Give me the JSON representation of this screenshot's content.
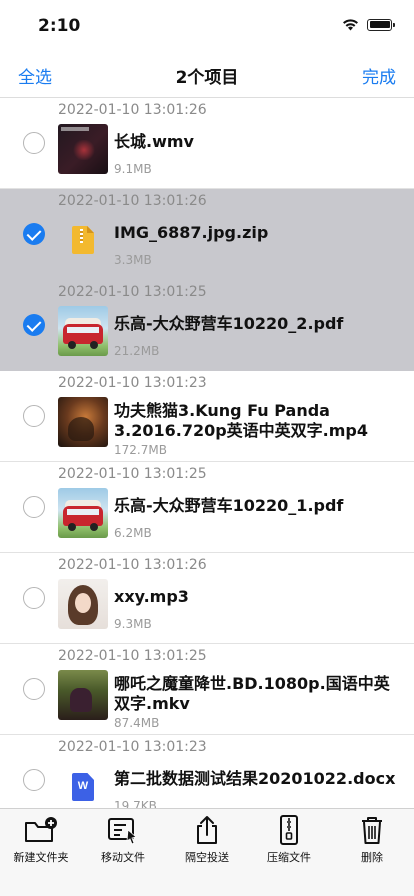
{
  "status_bar": {
    "time": "2:10"
  },
  "nav": {
    "select_all": "全选",
    "title": "2个项目",
    "done": "完成"
  },
  "files": [
    {
      "date": "2022-01-10 13:01:26",
      "name": "长城.wmv",
      "size": "9.1MB",
      "selected": false,
      "thumb": "video-thumbnail"
    },
    {
      "date": "2022-01-10 13:01:26",
      "name": "IMG_6887.jpg.zip",
      "size": "3.3MB",
      "selected": true,
      "thumb": "zip-icon"
    },
    {
      "date": "2022-01-10 13:01:25",
      "name": "乐高-大众野营车10220_2.pdf",
      "size": "21.2MB",
      "selected": true,
      "thumb": "pdf-thumbnail"
    },
    {
      "date": "2022-01-10 13:01:23",
      "name": "功夫熊猫3.Kung Fu Panda 3.2016.720p英语中英双字.mp4",
      "size": "172.7MB",
      "selected": false,
      "thumb": "video-thumbnail"
    },
    {
      "date": "2022-01-10 13:01:25",
      "name": "乐高-大众野营车10220_1.pdf",
      "size": "6.2MB",
      "selected": false,
      "thumb": "pdf-thumbnail"
    },
    {
      "date": "2022-01-10 13:01:26",
      "name": "xxy.mp3",
      "size": "9.3MB",
      "selected": false,
      "thumb": "album-art"
    },
    {
      "date": "2022-01-10 13:01:25",
      "name": "哪吒之魔童降世.BD.1080p.国语中英双字.mkv",
      "size": "87.4MB",
      "selected": false,
      "thumb": "video-thumbnail"
    },
    {
      "date": "2022-01-10 13:01:23",
      "name": "第二批数据测试结果20201022.docx",
      "size": "19.7KB",
      "selected": false,
      "thumb": "docx-icon"
    }
  ],
  "toolbar": {
    "new_folder": "新建文件夹",
    "move_file": "移动文件",
    "airdrop": "隔空投送",
    "compress": "压缩文件",
    "delete": "删除"
  },
  "colors": {
    "accent": "#1a7cf0",
    "selected_row": "#c8c8cd"
  }
}
